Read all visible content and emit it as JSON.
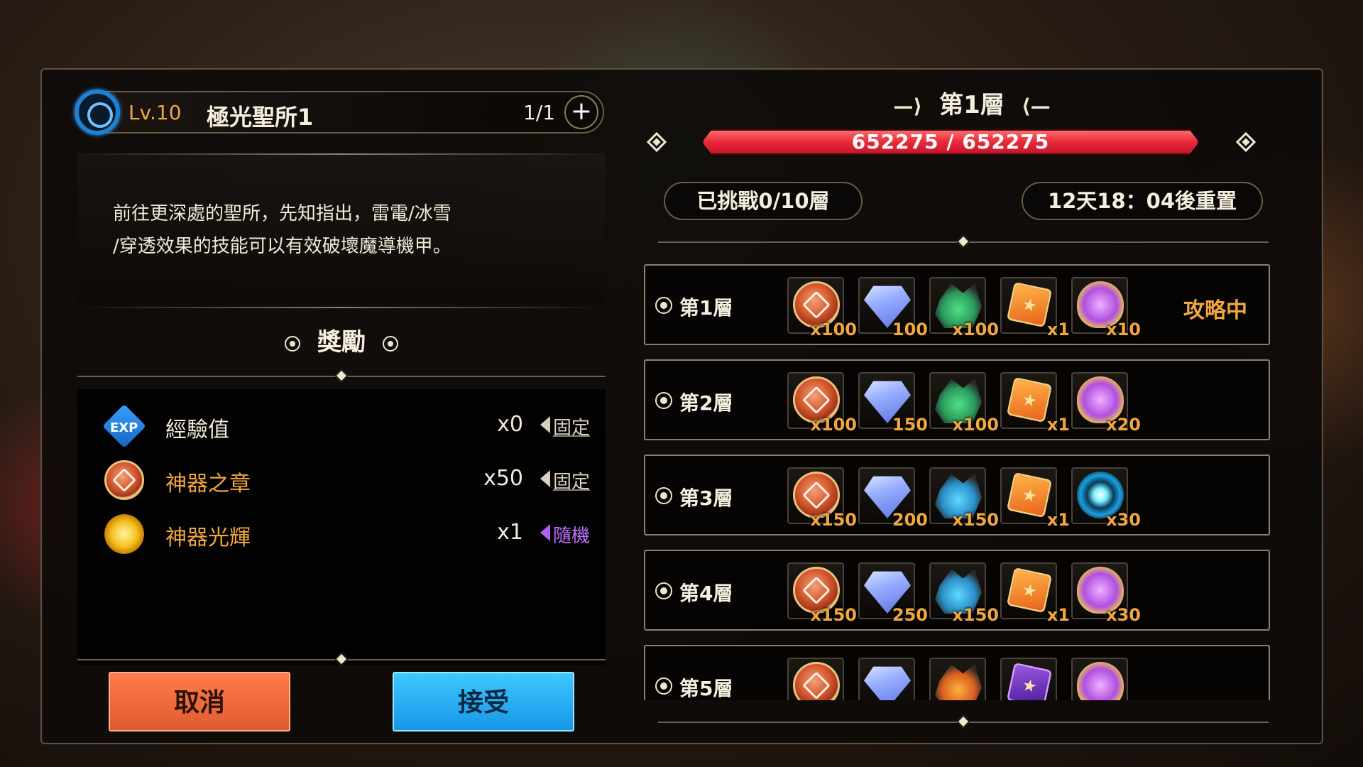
{
  "dungeon": {
    "level": "Lv.10",
    "name": "極光聖所1",
    "count": "1/1",
    "plus_label": "+",
    "description_line1": "前往更深處的聖所，先知指出，雷電/冰雪",
    "description_line2": "/穿透效果的技能可以有效破壞魔導機甲。"
  },
  "rewards": {
    "title": "獎勵",
    "items": [
      {
        "icon": "exp-icon",
        "icon_text": "EXP",
        "name": "經驗值",
        "qty": "x0",
        "tag": "固定",
        "name_color": "#f6efe0"
      },
      {
        "icon": "artifact-coin-icon",
        "name": "神器之章",
        "qty": "x50",
        "tag": "固定",
        "name_color": "#f2a640"
      },
      {
        "icon": "artifact-glow-icon",
        "name": "神器光輝",
        "qty": "x1",
        "tag": "隨機",
        "name_color": "#f2a640"
      }
    ]
  },
  "buttons": {
    "cancel": "取消",
    "accept": "接受"
  },
  "floor": {
    "title": "第1層",
    "hp_text": "652275 / 652275",
    "hp_fraction": 1.0,
    "challenged": "已挑戰0/10層",
    "reset": "12天18：04後重置"
  },
  "floors": [
    {
      "label": "第1層",
      "status": "攻略中",
      "items": [
        {
          "kind": "coin",
          "qty": "x100"
        },
        {
          "kind": "gem",
          "qty": "100"
        },
        {
          "kind": "crystals-green",
          "qty": "x100"
        },
        {
          "kind": "card-orange",
          "qty": "x1"
        },
        {
          "kind": "shield-purple",
          "qty": "x10"
        }
      ]
    },
    {
      "label": "第2層",
      "status": "",
      "items": [
        {
          "kind": "coin",
          "qty": "x100"
        },
        {
          "kind": "gem",
          "qty": "150"
        },
        {
          "kind": "crystals-green",
          "qty": "x100"
        },
        {
          "kind": "card-orange",
          "qty": "x1"
        },
        {
          "kind": "shield-purple",
          "qty": "x20"
        }
      ]
    },
    {
      "label": "第3層",
      "status": "",
      "items": [
        {
          "kind": "coin",
          "qty": "x150"
        },
        {
          "kind": "gem",
          "qty": "200"
        },
        {
          "kind": "crystals-blue",
          "qty": "x150"
        },
        {
          "kind": "card-orange",
          "qty": "x1"
        },
        {
          "kind": "ring-blue",
          "qty": "x30"
        }
      ]
    },
    {
      "label": "第4層",
      "status": "",
      "items": [
        {
          "kind": "coin",
          "qty": "x150"
        },
        {
          "kind": "gem",
          "qty": "250"
        },
        {
          "kind": "crystals-blue",
          "qty": "x150"
        },
        {
          "kind": "card-orange",
          "qty": "x1"
        },
        {
          "kind": "shield-purple",
          "qty": "x30"
        }
      ]
    },
    {
      "label": "第5層",
      "status": "",
      "items": [
        {
          "kind": "coin",
          "qty": ""
        },
        {
          "kind": "gem",
          "qty": ""
        },
        {
          "kind": "crystals-orange",
          "qty": ""
        },
        {
          "kind": "card-purple",
          "qty": ""
        },
        {
          "kind": "shield-purple",
          "qty": ""
        }
      ]
    }
  ]
}
